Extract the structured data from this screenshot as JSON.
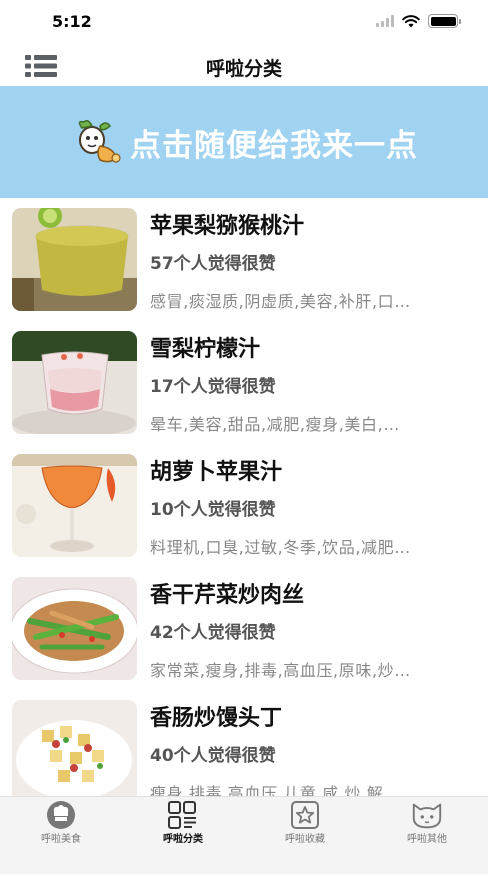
{
  "status_bar": {
    "time": "5:12"
  },
  "nav": {
    "title": "呼啦分类"
  },
  "banner": {
    "text": "点击随便给我来一点"
  },
  "recipes": [
    {
      "title": "苹果梨猕猴桃汁",
      "likes": "57个人觉得很赞",
      "tags": "感冒,痰湿质,阴虚质,美容,补肝,口…"
    },
    {
      "title": "雪梨柠檬汁",
      "likes": "17个人觉得很赞",
      "tags": "晕车,美容,甜品,减肥,瘦身,美白,…"
    },
    {
      "title": "胡萝卜苹果汁",
      "likes": "10个人觉得很赞",
      "tags": "料理机,口臭,过敏,冬季,饮品,减肥…"
    },
    {
      "title": "香干芹菜炒肉丝",
      "likes": "42个人觉得很赞",
      "tags": "家常菜,瘦身,排毒,高血压,原味,炒…"
    },
    {
      "title": "香肠炒馒头丁",
      "likes": "40个人觉得很赞",
      "tags": "瘦身,排毒,高血压,儿童,咸,炒,解…"
    }
  ],
  "tabs": [
    {
      "label": "呼啦美食",
      "icon": "chef-hat-icon"
    },
    {
      "label": "呼啦分类",
      "icon": "category-grid-icon"
    },
    {
      "label": "呼啦收藏",
      "icon": "star-favorite-icon"
    },
    {
      "label": "呼啦其他",
      "icon": "cat-face-icon"
    }
  ],
  "active_tab": "呼啦分类",
  "colors": {
    "banner": "#9fd3f1",
    "tabbar": "#f4f4f4"
  }
}
